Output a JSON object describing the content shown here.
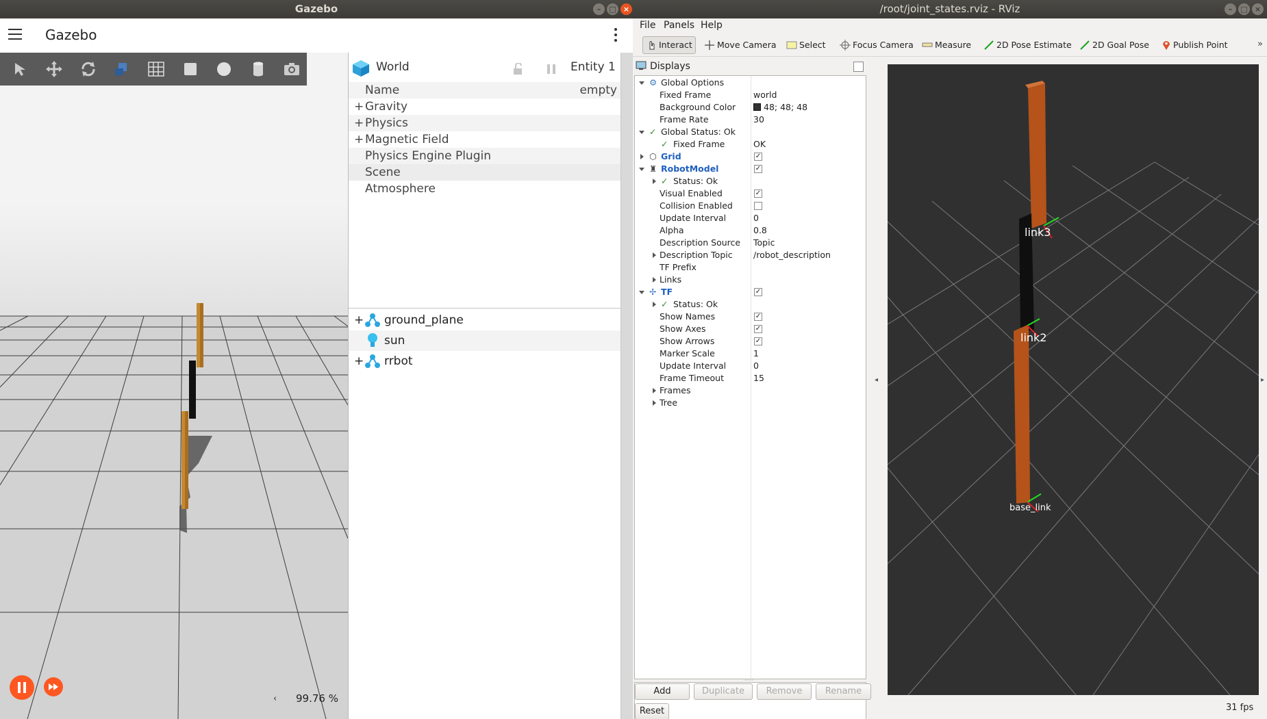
{
  "gazebo": {
    "window_title": "Gazebo",
    "app_title": "Gazebo",
    "component_inspector": {
      "entity_name": "World",
      "entity_label": "Entity 1",
      "name_label": "Name",
      "name_value": "empty",
      "groups": [
        "Gravity",
        "Physics",
        "Magnetic Field",
        "Physics Engine Plugin",
        "Scene",
        "Atmosphere"
      ]
    },
    "entity_tree": [
      {
        "name": "ground_plane",
        "icon": "model-icon",
        "expandable": true
      },
      {
        "name": "sun",
        "icon": "light-bulb-icon",
        "expandable": false
      },
      {
        "name": "rrbot",
        "icon": "model-icon",
        "expandable": true
      }
    ],
    "real_time_factor": "99.76 %",
    "accent_color": "#ff5722"
  },
  "rviz": {
    "window_title": "/root/joint_states.rviz - RViz",
    "menu": [
      "File",
      "Panels",
      "Help"
    ],
    "tools": [
      "Interact",
      "Move Camera",
      "Select",
      "Focus Camera",
      "Measure",
      "2D Pose Estimate",
      "2D Goal Pose",
      "Publish Point"
    ],
    "displays_title": "Displays",
    "tree": [
      {
        "name": "Global Options",
        "value": "",
        "level": 0,
        "expander": "down",
        "icon": "gear-icon"
      },
      {
        "name": "Fixed Frame",
        "value": "world",
        "level": 1
      },
      {
        "name": "Background Color",
        "value": "48; 48; 48",
        "level": 1,
        "swatch": "#303030"
      },
      {
        "name": "Frame Rate",
        "value": "30",
        "level": 1
      },
      {
        "name": "Global Status: Ok",
        "value": "",
        "level": 0,
        "expander": "down",
        "icon": "check-icon"
      },
      {
        "name": "Fixed Frame",
        "value": "OK",
        "level": 1,
        "icon": "check-icon"
      },
      {
        "name": "Grid",
        "value": "",
        "level": 0,
        "expander": "right",
        "icon": "grid-icon",
        "blue": true,
        "check": true
      },
      {
        "name": "RobotModel",
        "value": "",
        "level": 0,
        "expander": "down",
        "icon": "robot-icon",
        "blue": true,
        "check": true
      },
      {
        "name": "Status: Ok",
        "value": "",
        "level": 1,
        "expander": "right",
        "icon": "check-icon"
      },
      {
        "name": "Visual Enabled",
        "value": "",
        "level": 1,
        "check": true
      },
      {
        "name": "Collision Enabled",
        "value": "",
        "level": 1,
        "check": false
      },
      {
        "name": "Update Interval",
        "value": "0",
        "level": 1
      },
      {
        "name": "Alpha",
        "value": "0.8",
        "level": 1
      },
      {
        "name": "Description Source",
        "value": "Topic",
        "level": 1
      },
      {
        "name": "Description Topic",
        "value": "/robot_description",
        "level": 1,
        "expander": "right"
      },
      {
        "name": "TF Prefix",
        "value": "",
        "level": 1
      },
      {
        "name": "Links",
        "value": "",
        "level": 1,
        "expander": "right"
      },
      {
        "name": "TF",
        "value": "",
        "level": 0,
        "expander": "down",
        "icon": "tf-icon",
        "blue": true,
        "check": true
      },
      {
        "name": "Status: Ok",
        "value": "",
        "level": 1,
        "expander": "right",
        "icon": "check-icon"
      },
      {
        "name": "Show Names",
        "value": "",
        "level": 1,
        "check": true
      },
      {
        "name": "Show Axes",
        "value": "",
        "level": 1,
        "check": true
      },
      {
        "name": "Show Arrows",
        "value": "",
        "level": 1,
        "check": true
      },
      {
        "name": "Marker Scale",
        "value": "1",
        "level": 1
      },
      {
        "name": "Update Interval",
        "value": "0",
        "level": 1
      },
      {
        "name": "Frame Timeout",
        "value": "15",
        "level": 1
      },
      {
        "name": "Frames",
        "value": "",
        "level": 1,
        "expander": "right"
      },
      {
        "name": "Tree",
        "value": "",
        "level": 1,
        "expander": "right"
      }
    ],
    "buttons": {
      "add": "Add",
      "duplicate": "Duplicate",
      "remove": "Remove",
      "rename": "Rename",
      "reset": "Reset"
    },
    "frame_labels": [
      "link3",
      "link2",
      "base_link"
    ],
    "fps": "31 fps",
    "link_color": "#b5531a"
  }
}
